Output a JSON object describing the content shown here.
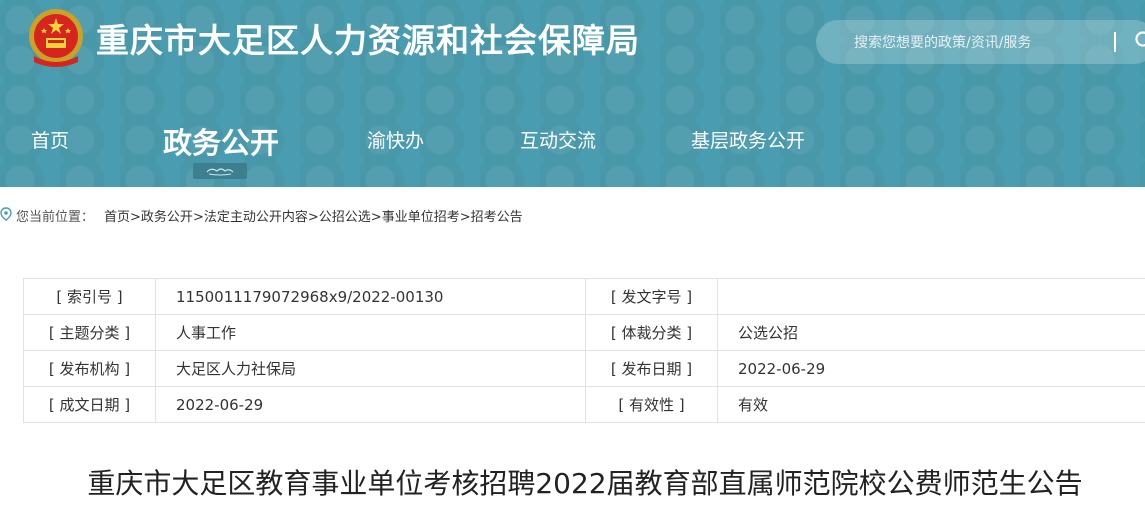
{
  "header": {
    "site_title": "重庆市大足区人力资源和社会保障局",
    "emblem_icon": "national-emblem-icon",
    "search": {
      "placeholder": "搜索您想要的政策/资讯/服务",
      "icon": "search-icon"
    }
  },
  "nav": {
    "items": [
      {
        "label": "首页"
      },
      {
        "label": "政务公开"
      },
      {
        "label": "渝快办"
      },
      {
        "label": "互动交流"
      },
      {
        "label": "基层政务公开"
      }
    ],
    "active_index": 1
  },
  "breadcrumb": {
    "label": "您当前位置：",
    "items": [
      "首页",
      "政务公开",
      "法定主动公开内容",
      "公招公选",
      "事业单位招考",
      "招考公告"
    ],
    "separator": ">"
  },
  "meta": {
    "rows": [
      {
        "l1": "[ 索引号 ]",
        "v1": "1150011179072968x9/2022-00130",
        "l2": "[ 发文字号 ]",
        "v2": ""
      },
      {
        "l1": "[ 主题分类 ]",
        "v1": "人事工作",
        "l2": "[ 体裁分类 ]",
        "v2": "公选公招"
      },
      {
        "l1": "[ 发布机构 ]",
        "v1": "大足区人力社保局",
        "l2": "[ 发布日期 ]",
        "v2": "2022-06-29"
      },
      {
        "l1": "[ 成文日期 ]",
        "v1": "2022-06-29",
        "l2": "[ 有效性 ]",
        "v2": "有效"
      }
    ]
  },
  "article": {
    "title": "重庆市大足区教育事业单位考核招聘2022届教育部直属师范院校公费师范生公告"
  },
  "colors": {
    "header_bg": "#4a9db0",
    "nav_underline": "#3d7f8f",
    "border": "#e2e2e2"
  }
}
